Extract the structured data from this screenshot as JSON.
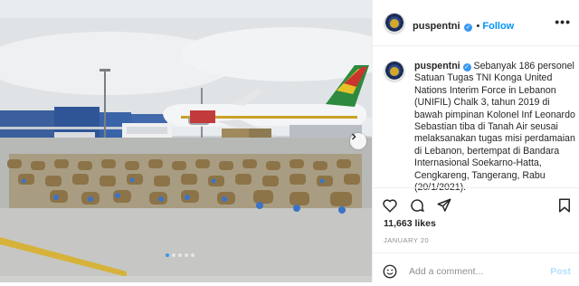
{
  "post": {
    "username": "puspentni",
    "follow_label": "Follow",
    "more_label": "•••",
    "caption": "Sebanyak 186 personel Satuan Tugas TNI Konga United Nations Interim Force in Lebanon (UNIFIL) Chalk 3, tahun 2019 di bawah pimpinan Kolonel Inf Leonardo Sebastian tiba di Tanah Air seusai melaksanakan tugas misi perdamaian di Lebanon, bertempat di Bandara Internasional Soekarno-Hatta, Cengkareng, Tangerang, Rabu (20/1/2021).",
    "likes": "11,663 likes",
    "date": "JANUARY 20",
    "comment_placeholder": "Add a comment...",
    "post_label": "Post"
  },
  "carousel": {
    "slides": 5,
    "active": 0
  },
  "colors": {
    "accent": "#0095f6",
    "verified": "#3897f0",
    "post_disabled": "#b2dffc"
  },
  "icons": [
    "heart-icon",
    "comment-icon",
    "share-icon",
    "bookmark-icon",
    "emoji-icon",
    "verified-icon",
    "chevron-right-icon"
  ]
}
